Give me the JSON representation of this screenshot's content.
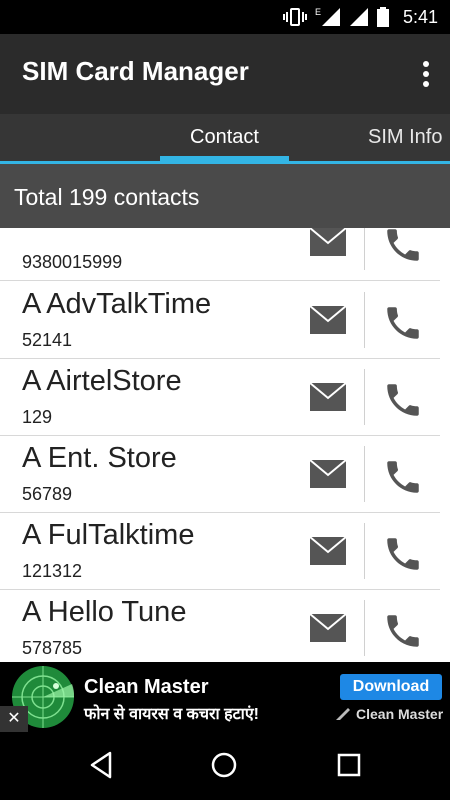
{
  "status": {
    "time": "5:41",
    "network_label": "E"
  },
  "app": {
    "title": "SIM Card Manager"
  },
  "tabs": [
    {
      "label": "Contact"
    },
    {
      "label": "SIM Info"
    }
  ],
  "summary": {
    "text": "Total 199 contacts"
  },
  "contacts": [
    {
      "name": "",
      "number": "9380015999"
    },
    {
      "name": "A AdvTalkTime",
      "number": "52141"
    },
    {
      "name": "A AirtelStore",
      "number": "129"
    },
    {
      "name": "A Ent. Store",
      "number": "56789"
    },
    {
      "name": "A FulTalktime",
      "number": "121312"
    },
    {
      "name": "A Hello Tune",
      "number": "578785"
    }
  ],
  "ad": {
    "title": "Clean Master",
    "subtitle": "फोन से वायरस व कचरा हटाएं!",
    "button": "Download",
    "brand": "Clean Master",
    "close": "✕"
  },
  "colors": {
    "accent": "#33b5e5",
    "action_icon": "#555555"
  }
}
